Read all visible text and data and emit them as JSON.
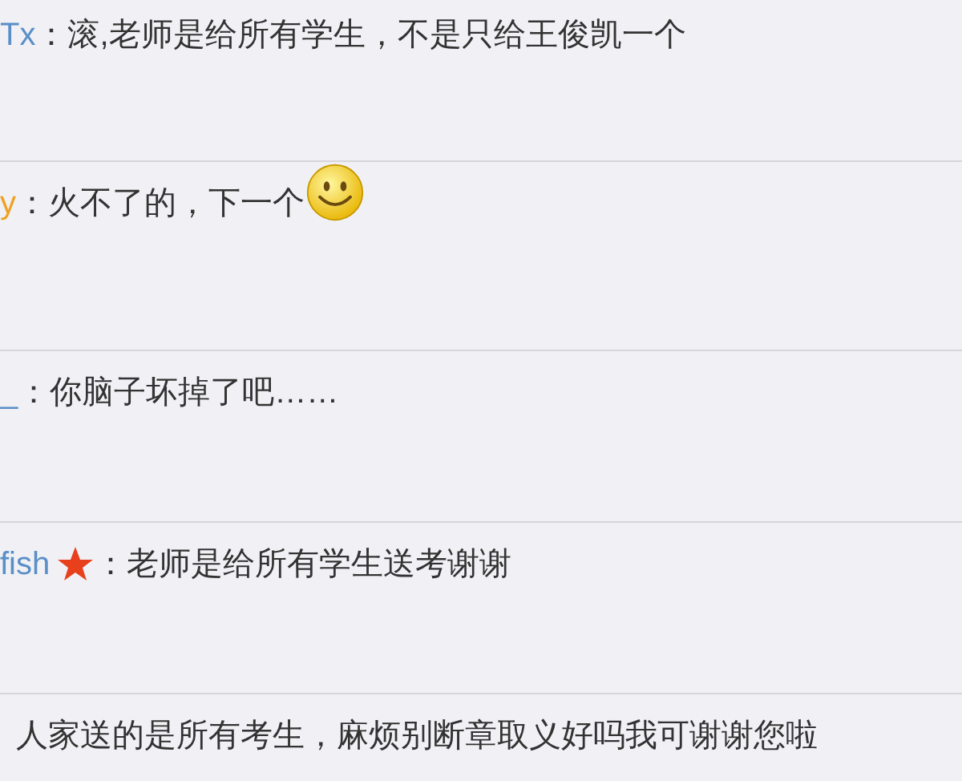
{
  "comments": [
    {
      "username": "Tx",
      "color": "#5a8fc8",
      "text": "：滚,老师是给所有学生，不是只给王俊凯一个"
    },
    {
      "username": "y",
      "color": "#f0a020",
      "text": "：火不了的，下一个",
      "emoji": true
    },
    {
      "username": "_",
      "color": "#5a8fc8",
      "text": "：你脑子坏掉了吧……"
    },
    {
      "username": "fish",
      "color": "#5a8fc8",
      "text": "：老师是给所有学生送考谢谢",
      "badge": true
    },
    {
      "text": "人家送的是所有考生，麻烦别断章取义好吗我可谢谢您啦"
    }
  ]
}
